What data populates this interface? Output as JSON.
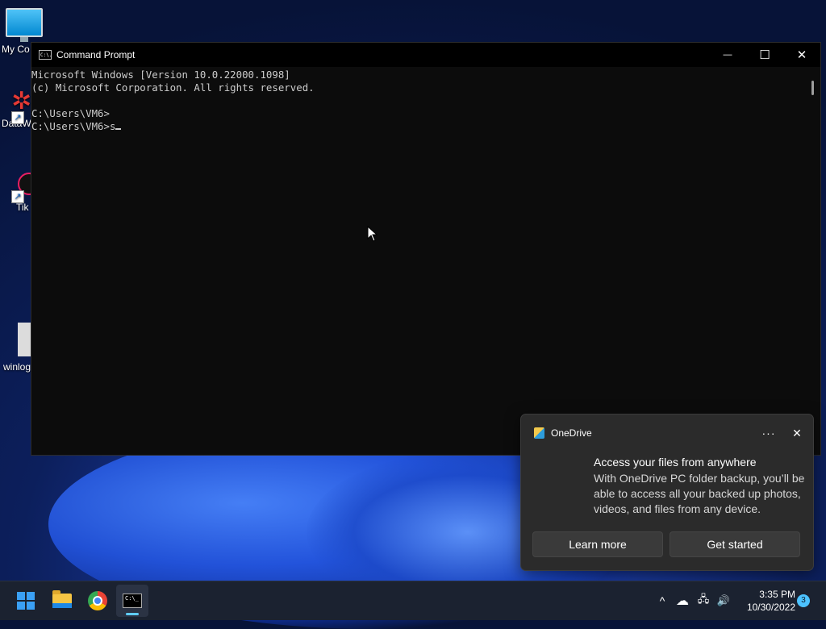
{
  "desktop": {
    "icons": [
      {
        "label": "My Co"
      },
      {
        "label": "DataW"
      },
      {
        "label": "Tik"
      },
      {
        "label": "winlog"
      }
    ]
  },
  "cmd_window": {
    "title": "Command Prompt",
    "app_icon_text": "C:\\.",
    "minimize": "—",
    "maximize": "☐",
    "close": "✕",
    "lines": [
      "Microsoft Windows [Version 10.0.22000.1098]",
      "(c) Microsoft Corporation. All rights reserved.",
      "",
      "C:\\Users\\VM6>",
      "C:\\Users\\VM6>s"
    ]
  },
  "toast": {
    "app_name": "OneDrive",
    "more": "···",
    "close": "✕",
    "title": "Access your files from anywhere",
    "body": "With OneDrive PC folder backup, you’ll be able to access all your backed up photos, videos, and files from any device.",
    "learn_more": "Learn more",
    "get_started": "Get started"
  },
  "taskbar": {
    "tray": {
      "chevron": "^",
      "cloud": "☁",
      "network": "🖧",
      "volume": "🔊"
    },
    "time": "3:35 PM",
    "date": "10/30/2022",
    "notifications": "3"
  }
}
